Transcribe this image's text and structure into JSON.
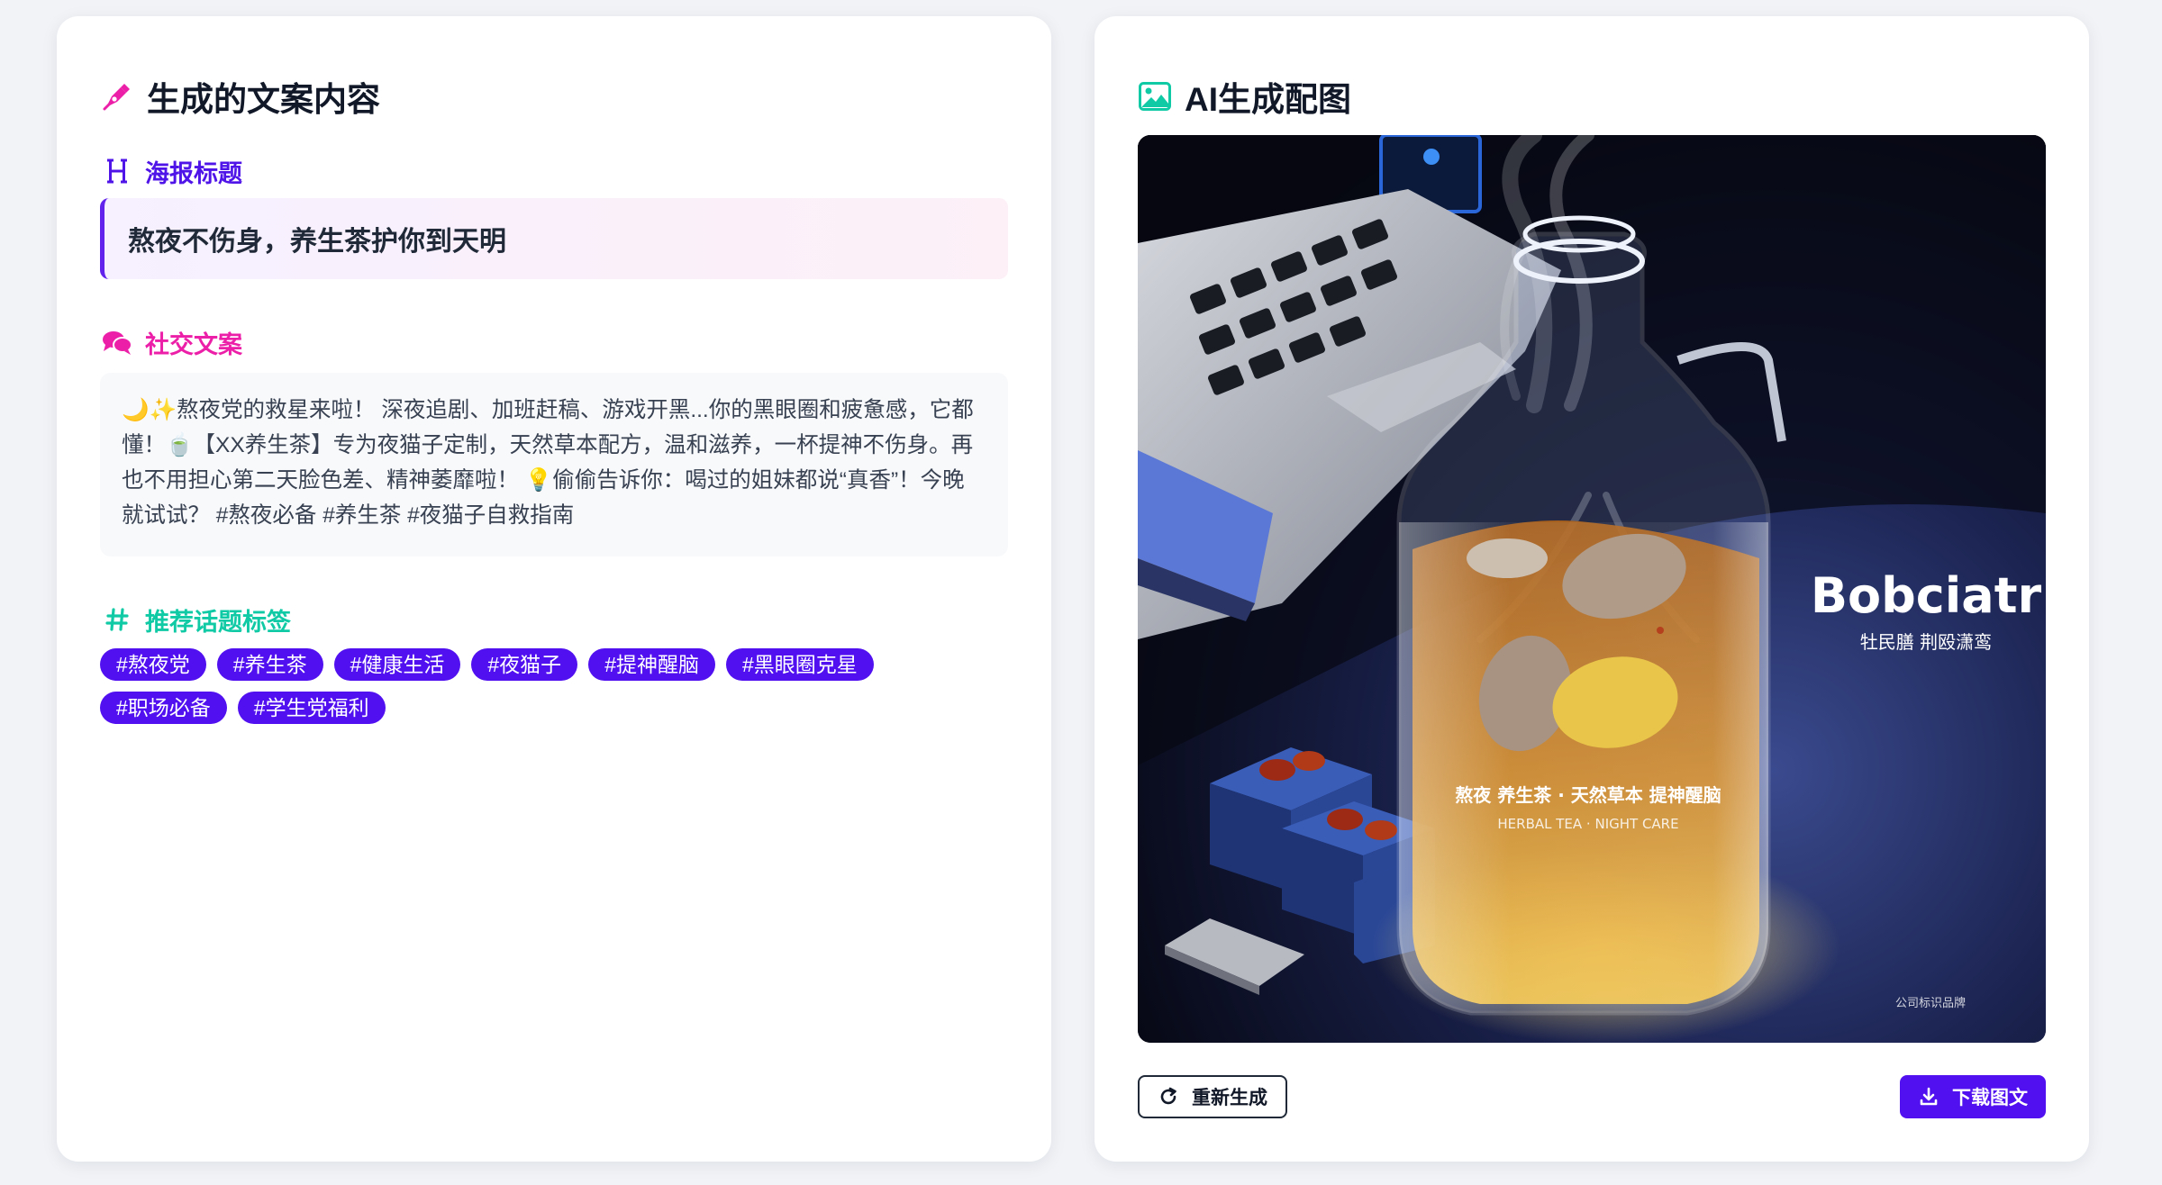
{
  "left_card": {
    "title": "生成的文案内容",
    "poster_title_label": "海报标题",
    "poster_title": "熬夜不伤身，养生茶护你到天明",
    "social_label": "社交文案",
    "social_text": "🌙✨熬夜党的救星来啦！ 深夜追剧、加班赶稿、游戏开黑...你的黑眼圈和疲惫感，它都懂！🍵【XX养生茶】专为夜猫子定制，天然草本配方，温和滋养，一杯提神不伤身。再也不用担心第二天脸色差、精神萎靡啦！ 💡偷偷告诉你：喝过的姐妹都说“真香”！今晚就试试？ #熬夜必备 #养生茶 #夜猫子自救指南",
    "tags_label": "推荐话题标签",
    "tags": [
      "#熬夜党",
      "#养生茶",
      "#健康生活",
      "#夜猫子",
      "#提神醒脑",
      "#黑眼圈克星",
      "#职场必备",
      "#学生党福利"
    ]
  },
  "right_card": {
    "title": "AI生成配图",
    "image_brand": "Bobciatr",
    "image_brand_sub": "牡民膳 荆殴潇鸾",
    "image_bottle_text_1": "熬夜 养生茶 · 天然草本 提神醒脑",
    "image_bottle_text_2": "HERBAL TEA · NIGHT CARE",
    "image_corner_text": "公司标识品牌",
    "regenerate_label": "重新生成",
    "download_label": "下载图文"
  },
  "colors": {
    "accent_purple": "#5010f0",
    "pink": "#ec1fa8",
    "teal": "#10c9a5",
    "title_purple": "#4f14e8"
  },
  "icons": {
    "left_title": "pen-nib-icon",
    "poster_title": "heading-icon",
    "social": "comments-icon",
    "tags": "hashtag-icon",
    "right_title": "image-icon",
    "regenerate": "rotate-right-icon",
    "download": "download-icon"
  }
}
